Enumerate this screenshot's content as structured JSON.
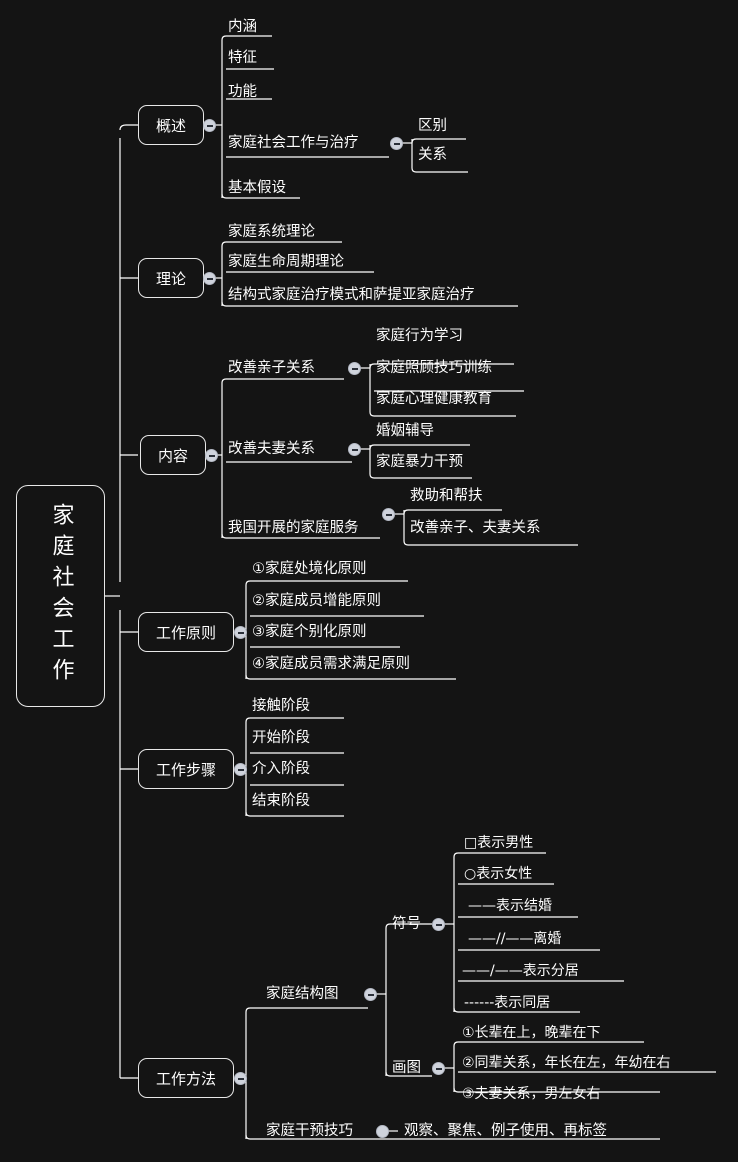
{
  "meta": {
    "title": "家庭社会工作 思维导图",
    "background_color": "#141414",
    "text_color": "#fdfdfd",
    "line_color": "#ffffff",
    "toggle_color": "#cfd3dc"
  },
  "root": {
    "label": "家庭社会工作"
  },
  "branches": [
    {
      "id": "overview",
      "label": "概述",
      "children": [
        {
          "label": "内涵"
        },
        {
          "label": "特征"
        },
        {
          "label": "功能"
        },
        {
          "label": "家庭社会工作与治疗",
          "children": [
            {
              "label": "区别"
            },
            {
              "label": "关系"
            }
          ]
        },
        {
          "label": "基本假设"
        }
      ]
    },
    {
      "id": "theory",
      "label": "理论",
      "children": [
        {
          "label": "家庭系统理论"
        },
        {
          "label": "家庭生命周期理论"
        },
        {
          "label": "结构式家庭治疗模式和萨提亚家庭治疗"
        }
      ]
    },
    {
      "id": "content",
      "label": "内容",
      "children": [
        {
          "label": "改善亲子关系",
          "children": [
            {
              "label": "家庭行为学习"
            },
            {
              "label": "家庭照顾技巧训练"
            },
            {
              "label": "家庭心理健康教育"
            }
          ]
        },
        {
          "label": "改善夫妻关系",
          "children": [
            {
              "label": "婚姻辅导"
            },
            {
              "label": "家庭暴力干预"
            }
          ]
        },
        {
          "label": "我国开展的家庭服务",
          "children": [
            {
              "label": "救助和帮扶"
            },
            {
              "label": "改善亲子、夫妻关系"
            }
          ]
        }
      ]
    },
    {
      "id": "principles",
      "label": "工作原则",
      "children": [
        {
          "label": "①家庭处境化原则"
        },
        {
          "label": "②家庭成员增能原则"
        },
        {
          "label": "③家庭个别化原则"
        },
        {
          "label": "④家庭成员需求满足原则"
        }
      ]
    },
    {
      "id": "steps",
      "label": "工作步骤",
      "children": [
        {
          "label": "接触阶段"
        },
        {
          "label": "开始阶段"
        },
        {
          "label": "介入阶段"
        },
        {
          "label": "结束阶段"
        }
      ]
    },
    {
      "id": "methods",
      "label": "工作方法",
      "children": [
        {
          "label": "家庭结构图",
          "children": [
            {
              "label": "符号",
              "children": [
                {
                  "label": "□表示男性"
                },
                {
                  "label": "○表示女性"
                },
                {
                  "label": "——表示结婚"
                },
                {
                  "label": "——//——离婚"
                },
                {
                  "label": "——/——表示分居"
                },
                {
                  "label": "------表示同居"
                }
              ]
            },
            {
              "label": "画图",
              "children": [
                {
                  "label": "①长辈在上，晚辈在下"
                },
                {
                  "label": "②同辈关系，年长在左，年幼在右"
                },
                {
                  "label": "③夫妻关系，男左女右"
                }
              ]
            }
          ]
        },
        {
          "label": "家庭干预技巧",
          "children": [
            {
              "label": "观察、聚焦、例子使用、再标签"
            }
          ]
        }
      ]
    }
  ]
}
